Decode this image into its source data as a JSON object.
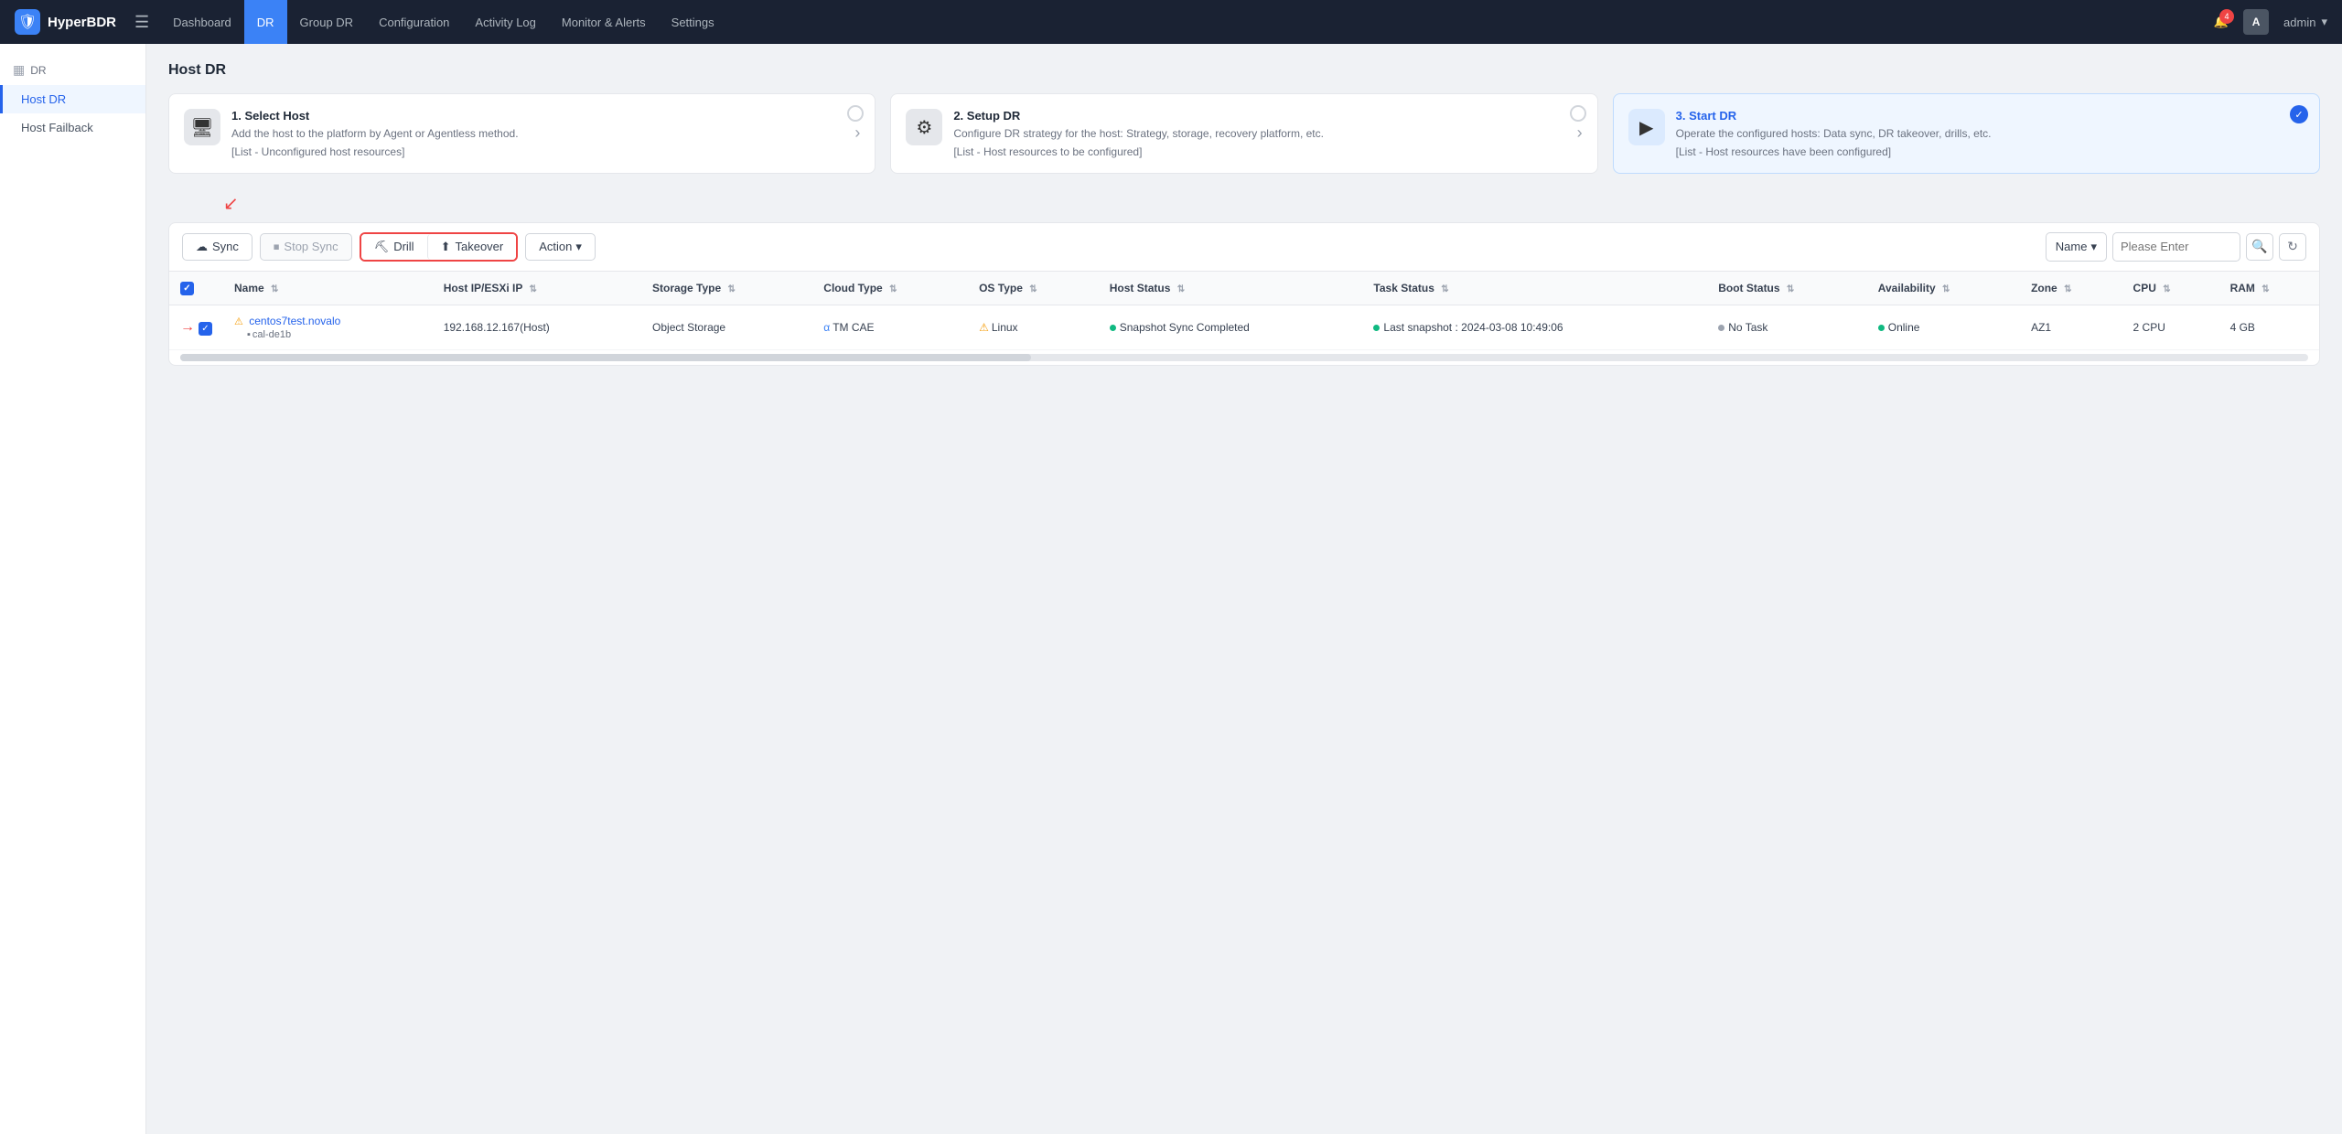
{
  "topnav": {
    "logo_text": "HyperBDR",
    "hamburger": "☰",
    "nav_items": [
      {
        "label": "Dashboard",
        "active": false
      },
      {
        "label": "DR",
        "active": true
      },
      {
        "label": "Group DR",
        "active": false
      },
      {
        "label": "Configuration",
        "active": false
      },
      {
        "label": "Activity Log",
        "active": false
      },
      {
        "label": "Monitor & Alerts",
        "active": false
      },
      {
        "label": "Settings",
        "active": false
      }
    ],
    "notification_count": "4",
    "admin_label": "admin",
    "admin_initial": "A"
  },
  "sidebar": {
    "section_label": "DR",
    "items": [
      {
        "label": "Host DR",
        "active": true
      },
      {
        "label": "Host Failback",
        "active": false
      }
    ]
  },
  "page": {
    "title": "Host DR"
  },
  "steps": [
    {
      "number": "1",
      "title": "1. Select Host",
      "desc": "Add the host to the platform by Agent or Agentless method.",
      "link": "[List - Unconfigured host resources]",
      "active": false,
      "checked": false,
      "icon": "🖥"
    },
    {
      "number": "2",
      "title": "2. Setup DR",
      "desc": "Configure DR strategy for the host: Strategy, storage, recovery platform, etc.",
      "link": "[List - Host resources to be configured]",
      "active": false,
      "checked": false,
      "icon": "⚙"
    },
    {
      "number": "3",
      "title": "3. Start DR",
      "desc": "Operate the configured hosts: Data sync, DR takeover, drills, etc.",
      "link": "[List - Host resources have been configured]",
      "active": true,
      "checked": true,
      "icon": "▶"
    }
  ],
  "toolbar": {
    "sync_label": "Sync",
    "stop_sync_label": "Stop Sync",
    "drill_label": "Drill",
    "takeover_label": "Takeover",
    "action_label": "Action",
    "search_field_label": "Name",
    "search_placeholder": "Please Enter",
    "refresh_icon": "↻",
    "search_icon": "🔍"
  },
  "table": {
    "columns": [
      {
        "key": "checkbox",
        "label": ""
      },
      {
        "key": "name",
        "label": "Name"
      },
      {
        "key": "host_ip",
        "label": "Host IP/ESXi IP"
      },
      {
        "key": "storage_type",
        "label": "Storage Type"
      },
      {
        "key": "cloud_type",
        "label": "Cloud Type"
      },
      {
        "key": "os_type",
        "label": "OS Type"
      },
      {
        "key": "host_status",
        "label": "Host Status"
      },
      {
        "key": "task_status",
        "label": "Task Status"
      },
      {
        "key": "boot_status",
        "label": "Boot Status"
      },
      {
        "key": "availability",
        "label": "Availability"
      },
      {
        "key": "zone",
        "label": "Zone"
      },
      {
        "key": "cpu",
        "label": "CPU"
      },
      {
        "key": "ram",
        "label": "RAM"
      }
    ],
    "rows": [
      {
        "checked": true,
        "name_primary": "centos7test.novalo",
        "name_secondary": "cal-de1b",
        "host_ip": "192.168.12.167(Host)",
        "storage_type": "Object Storage",
        "cloud_type": "TM CAE",
        "os_type": "Linux",
        "host_status": "Snapshot Sync Completed",
        "task_status": "Last snapshot : 2024-03-08 10:49:06",
        "boot_status": "No Task",
        "availability": "Online",
        "zone": "AZ1",
        "cpu": "2 CPU",
        "ram": "4 GB"
      }
    ]
  }
}
